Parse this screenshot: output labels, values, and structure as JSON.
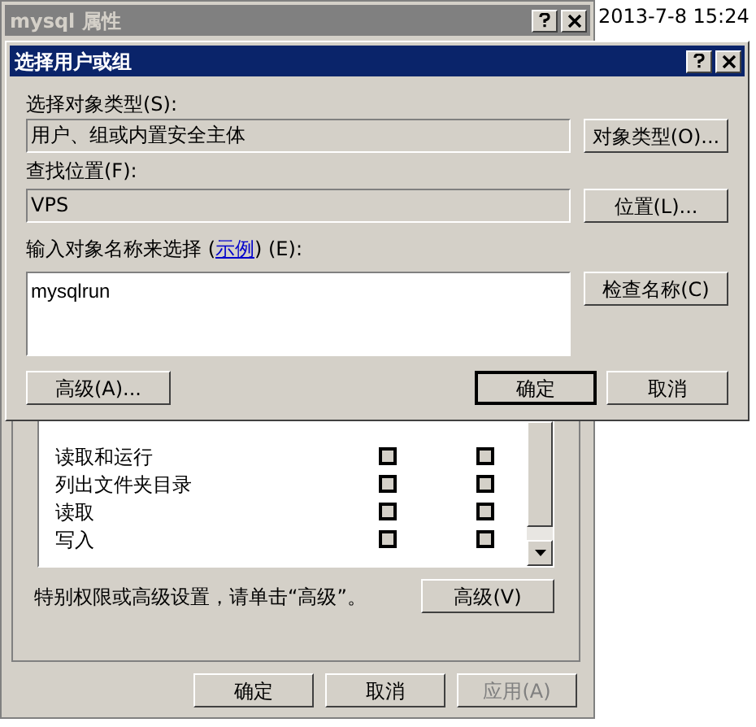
{
  "desktop": {
    "timestamps": [
      "2013-7-8 15:24"
    ]
  },
  "background_window": {
    "title": "mysql 属性",
    "active": false,
    "permissions": [
      {
        "name": "读取和运行",
        "allow": false,
        "deny": false
      },
      {
        "name": "列出文件夹目录",
        "allow": false,
        "deny": false
      },
      {
        "name": "读取",
        "allow": false,
        "deny": false
      },
      {
        "name": "写入",
        "allow": false,
        "deny": false
      }
    ],
    "hint": "特别权限或高级设置，请单击“高级”。",
    "advanced_button": "高级(V)",
    "buttons": [
      {
        "label": "确定",
        "disabled": false
      },
      {
        "label": "取消",
        "disabled": false
      },
      {
        "label": "应用(A)",
        "disabled": true
      }
    ]
  },
  "dialog": {
    "title": "选择用户或组",
    "active": true,
    "object_types_label": "选择对象类型(S):",
    "object_types_value": "用户、组或内置安全主体",
    "object_types_button": "对象类型(O)...",
    "location_label": "查找位置(F):",
    "location_value": "VPS",
    "location_button": "位置(L)...",
    "names_label_before": "输入对象名称来选择 (",
    "names_label_link": "示例",
    "names_label_after": ") (E):",
    "names_value": "mysqlrun",
    "check_names_button": "检查名称(C)",
    "advanced_button": "高级(A)...",
    "buttons": [
      {
        "label": "确定",
        "default": true
      },
      {
        "label": "取消",
        "default": false
      }
    ]
  }
}
